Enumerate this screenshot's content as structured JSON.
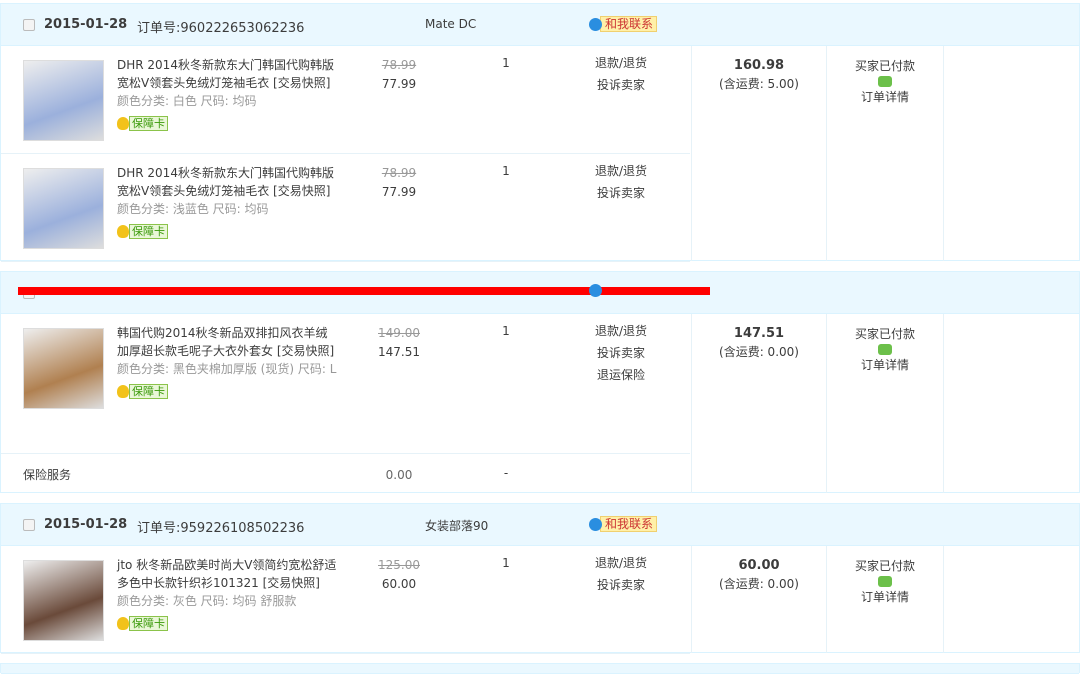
{
  "orders": [
    {
      "date": "2015-01-28",
      "order_label": "订单号:",
      "order_no": "960222653062236",
      "shop": "Mate DC",
      "contact": "和我联系",
      "items": [
        {
          "title": "DHR 2014秋冬新款东大门韩国代购韩版宽松V领套头免绒灯笼袖毛衣 [交易快照]",
          "sku": "颜色分类: 白色 尺码: 均码",
          "badge": "保障卡",
          "old_price": "78.99",
          "price": "77.99",
          "qty": "1",
          "actions": [
            "退款/退货",
            "投诉卖家"
          ],
          "img": "#9bb0dc"
        },
        {
          "title": "DHR 2014秋冬新款东大门韩国代购韩版宽松V领套头免绒灯笼袖毛衣 [交易快照]",
          "sku": "颜色分类: 浅蓝色 尺码: 均码",
          "badge": "保障卡",
          "old_price": "78.99",
          "price": "77.99",
          "qty": "1",
          "actions": [
            "退款/退货",
            "投诉卖家"
          ],
          "img": "#9bb0dc"
        }
      ],
      "total": "160.98",
      "shipping": "(含运费: 5.00)",
      "status": "买家已付款",
      "detail": "订单详情"
    },
    {
      "date": "",
      "order_label": "",
      "order_no": "",
      "shop": "",
      "contact": "",
      "items": [
        {
          "title": "韩国代购2014秋冬新品双排扣风衣羊绒加厚超长款毛呢子大衣外套女 [交易快照]",
          "sku": "颜色分类: 黑色夹棉加厚版 (现货) 尺码: L",
          "badge": "保障卡",
          "old_price": "149.00",
          "price": "147.51",
          "qty": "1",
          "actions": [
            "退款/退货",
            "投诉卖家",
            "退运保险"
          ],
          "img": "#b08050"
        }
      ],
      "insurance": {
        "label": "保险服务",
        "price": "0.00",
        "qty": "-"
      },
      "total": "147.51",
      "shipping": "(含运费: 0.00)",
      "status": "买家已付款",
      "detail": "订单详情"
    },
    {
      "date": "2015-01-28",
      "order_label": "订单号:",
      "order_no": "959226108502236",
      "shop": "女装部落90",
      "contact": "和我联系",
      "items": [
        {
          "title": "jto 秋冬新品欧美时尚大V领简约宽松舒适多色中长款针织衫101321 [交易快照]",
          "sku": "颜色分类: 灰色 尺码: 均码 舒服款",
          "badge": "保障卡",
          "old_price": "125.00",
          "price": "60.00",
          "qty": "1",
          "actions": [
            "退款/退货",
            "投诉卖家"
          ],
          "img": "#6a4a3a"
        }
      ],
      "total": "60.00",
      "shipping": "(含运费: 0.00)",
      "status": "买家已付款",
      "detail": "订单详情"
    }
  ]
}
